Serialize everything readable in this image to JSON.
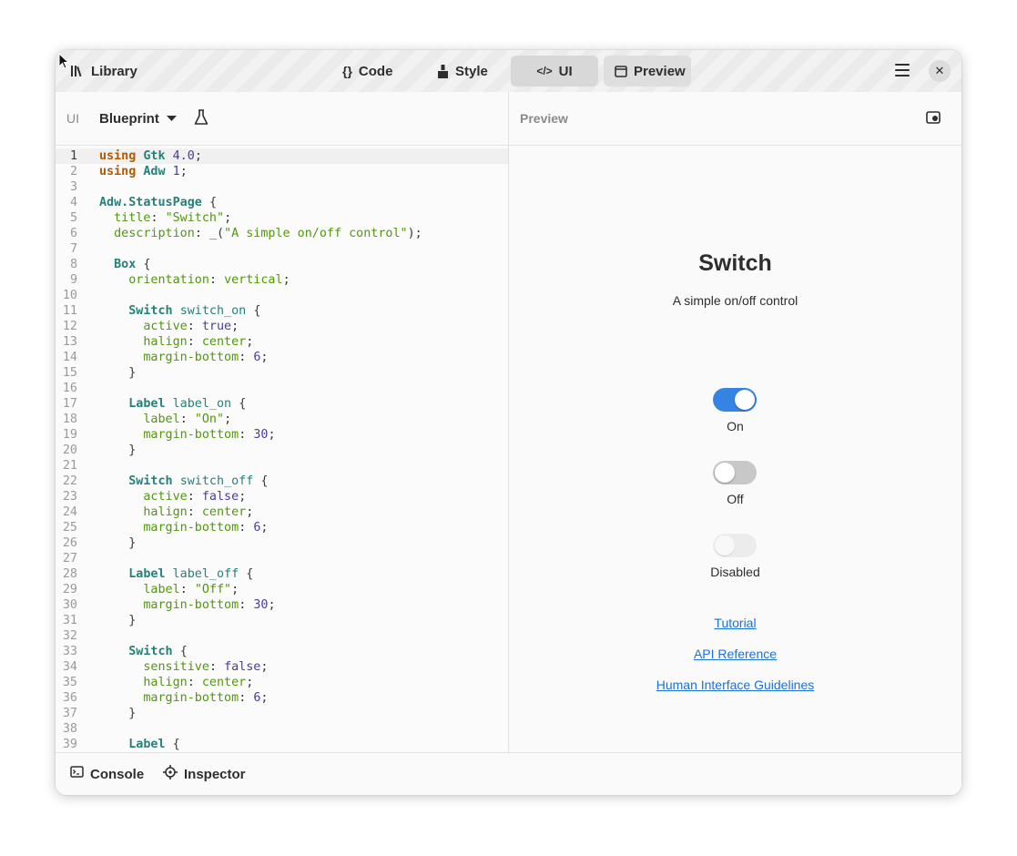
{
  "header": {
    "library_label": "Library",
    "tabs": [
      {
        "label": "Code",
        "icon": "braces-icon"
      },
      {
        "label": "Style",
        "icon": "brush-icon"
      },
      {
        "label": "UI",
        "icon": "code-tag-icon"
      },
      {
        "label": "Preview",
        "icon": "window-icon"
      }
    ],
    "close_glyph": "✕"
  },
  "ui_toolbar": {
    "section_label": "UI",
    "language_label": "Blueprint"
  },
  "preview_toolbar": {
    "title": "Preview"
  },
  "editor": {
    "lines": [
      {
        "n": "1",
        "html": "<span class='kw'>using</span> <span class='ty'>Gtk</span> <span class='nm'>4.0</span><span class='pu'>;</span>"
      },
      {
        "n": "2",
        "html": "<span class='kw'>using</span> <span class='ty'>Adw</span> <span class='nm'>1</span><span class='pu'>;</span>"
      },
      {
        "n": "3",
        "html": ""
      },
      {
        "n": "4",
        "html": "<span class='ty'>Adw.StatusPage</span> <span class='pu'>{</span>"
      },
      {
        "n": "5",
        "html": "  <span class='pr'>title</span><span class='pu'>:</span> <span class='st'>\"Switch\"</span><span class='pu'>;</span>"
      },
      {
        "n": "6",
        "html": "  <span class='pr'>description</span><span class='pu'>:</span> <span class='pu'>_(</span><span class='st'>\"A simple on/off control\"</span><span class='pu'>);</span>"
      },
      {
        "n": "7",
        "html": ""
      },
      {
        "n": "8",
        "html": "  <span class='ty'>Box</span> <span class='pu'>{</span>"
      },
      {
        "n": "9",
        "html": "    <span class='pr'>orientation</span><span class='pu'>:</span> <span class='st'>vertical</span><span class='pu'>;</span>"
      },
      {
        "n": "10",
        "html": ""
      },
      {
        "n": "11",
        "html": "    <span class='ty'>Switch</span> <span class='id'>switch_on</span> <span class='pu'>{</span>"
      },
      {
        "n": "12",
        "html": "      <span class='pr'>active</span><span class='pu'>:</span> <span class='nm'>true</span><span class='pu'>;</span>"
      },
      {
        "n": "13",
        "html": "      <span class='pr'>halign</span><span class='pu'>:</span> <span class='st'>center</span><span class='pu'>;</span>"
      },
      {
        "n": "14",
        "html": "      <span class='pr'>margin-bottom</span><span class='pu'>:</span> <span class='nm'>6</span><span class='pu'>;</span>"
      },
      {
        "n": "15",
        "html": "    <span class='pu'>}</span>"
      },
      {
        "n": "16",
        "html": ""
      },
      {
        "n": "17",
        "html": "    <span class='ty'>Label</span> <span class='id'>label_on</span> <span class='pu'>{</span>"
      },
      {
        "n": "18",
        "html": "      <span class='pr'>label</span><span class='pu'>:</span> <span class='st'>\"On\"</span><span class='pu'>;</span>"
      },
      {
        "n": "19",
        "html": "      <span class='pr'>margin-bottom</span><span class='pu'>:</span> <span class='nm'>30</span><span class='pu'>;</span>"
      },
      {
        "n": "20",
        "html": "    <span class='pu'>}</span>"
      },
      {
        "n": "21",
        "html": ""
      },
      {
        "n": "22",
        "html": "    <span class='ty'>Switch</span> <span class='id'>switch_off</span> <span class='pu'>{</span>"
      },
      {
        "n": "23",
        "html": "      <span class='pr'>active</span><span class='pu'>:</span> <span class='nm'>false</span><span class='pu'>;</span>"
      },
      {
        "n": "24",
        "html": "      <span class='pr'>halign</span><span class='pu'>:</span> <span class='st'>center</span><span class='pu'>;</span>"
      },
      {
        "n": "25",
        "html": "      <span class='pr'>margin-bottom</span><span class='pu'>:</span> <span class='nm'>6</span><span class='pu'>;</span>"
      },
      {
        "n": "26",
        "html": "    <span class='pu'>}</span>"
      },
      {
        "n": "27",
        "html": ""
      },
      {
        "n": "28",
        "html": "    <span class='ty'>Label</span> <span class='id'>label_off</span> <span class='pu'>{</span>"
      },
      {
        "n": "29",
        "html": "      <span class='pr'>label</span><span class='pu'>:</span> <span class='st'>\"Off\"</span><span class='pu'>;</span>"
      },
      {
        "n": "30",
        "html": "      <span class='pr'>margin-bottom</span><span class='pu'>:</span> <span class='nm'>30</span><span class='pu'>;</span>"
      },
      {
        "n": "31",
        "html": "    <span class='pu'>}</span>"
      },
      {
        "n": "32",
        "html": ""
      },
      {
        "n": "33",
        "html": "    <span class='ty'>Switch</span> <span class='pu'>{</span>"
      },
      {
        "n": "34",
        "html": "      <span class='pr'>sensitive</span><span class='pu'>:</span> <span class='nm'>false</span><span class='pu'>;</span>"
      },
      {
        "n": "35",
        "html": "      <span class='pr'>halign</span><span class='pu'>:</span> <span class='st'>center</span><span class='pu'>;</span>"
      },
      {
        "n": "36",
        "html": "      <span class='pr'>margin-bottom</span><span class='pu'>:</span> <span class='nm'>6</span><span class='pu'>;</span>"
      },
      {
        "n": "37",
        "html": "    <span class='pu'>}</span>"
      },
      {
        "n": "38",
        "html": ""
      },
      {
        "n": "39",
        "html": "    <span class='ty'>Label</span> <span class='pu'>{</span>"
      }
    ]
  },
  "preview": {
    "title": "Switch",
    "description": "A simple on/off control",
    "switches": [
      {
        "label": "On",
        "state": "on"
      },
      {
        "label": "Off",
        "state": "off"
      },
      {
        "label": "Disabled",
        "state": "disabled"
      }
    ],
    "links": [
      "Tutorial",
      "API Reference",
      "Human Interface Guidelines"
    ]
  },
  "bottom": {
    "console_label": "Console",
    "inspector_label": "Inspector"
  },
  "colors": {
    "accent": "#3584e4",
    "link": "#1c71d8"
  }
}
